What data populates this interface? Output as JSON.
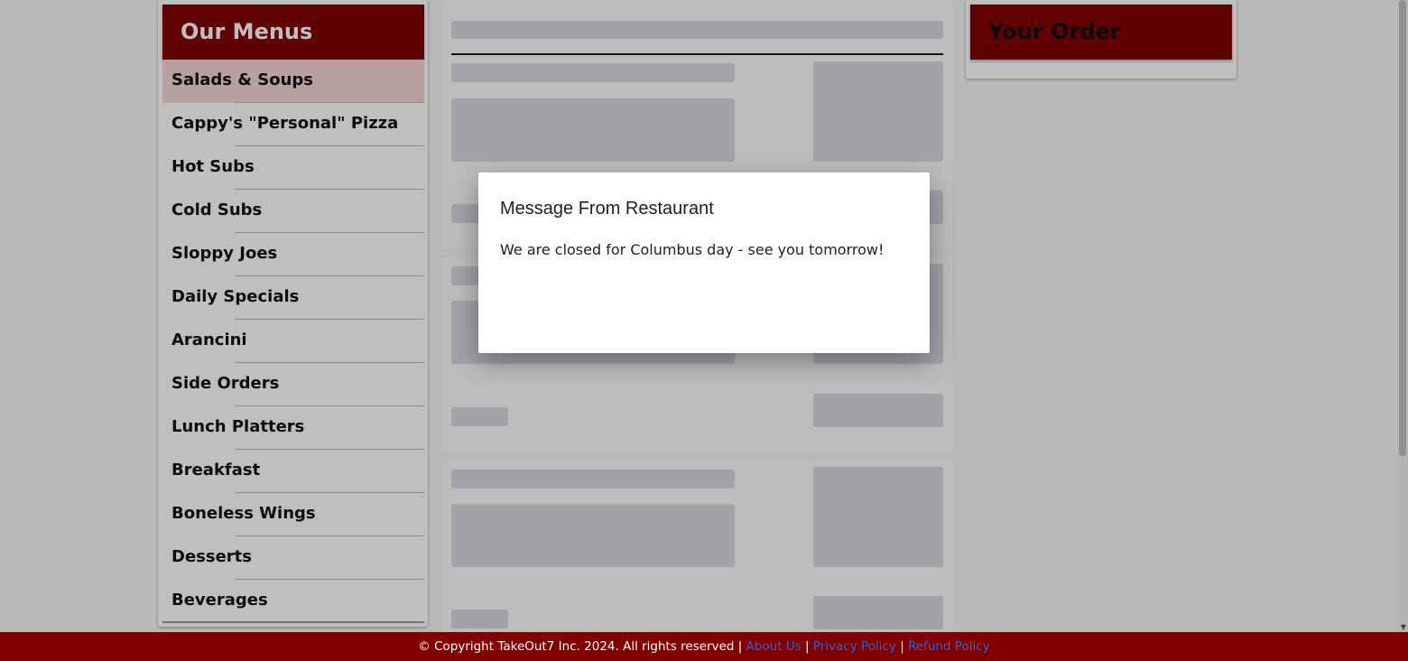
{
  "menu": {
    "title": "Our Menus",
    "items": [
      {
        "label": "Salads & Soups"
      },
      {
        "label": "Cappy's \"Personal\" Pizza"
      },
      {
        "label": "Hot Subs"
      },
      {
        "label": "Cold Subs"
      },
      {
        "label": "Sloppy Joes"
      },
      {
        "label": "Daily Specials"
      },
      {
        "label": "Arancini"
      },
      {
        "label": "Side Orders"
      },
      {
        "label": "Lunch Platters"
      },
      {
        "label": "Breakfast"
      },
      {
        "label": "Boneless Wings"
      },
      {
        "label": "Desserts"
      },
      {
        "label": "Beverages"
      }
    ]
  },
  "order": {
    "title": "Your Order"
  },
  "modal": {
    "title": "Message From Restaurant",
    "message": "We are closed for Columbus day - see you tomorrow!"
  },
  "footer": {
    "copyright": "© Copyright TakeOut7 Inc. 2024. All rights reserved |",
    "about": "About Us",
    "privacy": "Privacy Policy",
    "refund": "Refund Policy",
    "separator": "|"
  },
  "colors": {
    "brand": "#800000",
    "link": "#2f62d6"
  }
}
